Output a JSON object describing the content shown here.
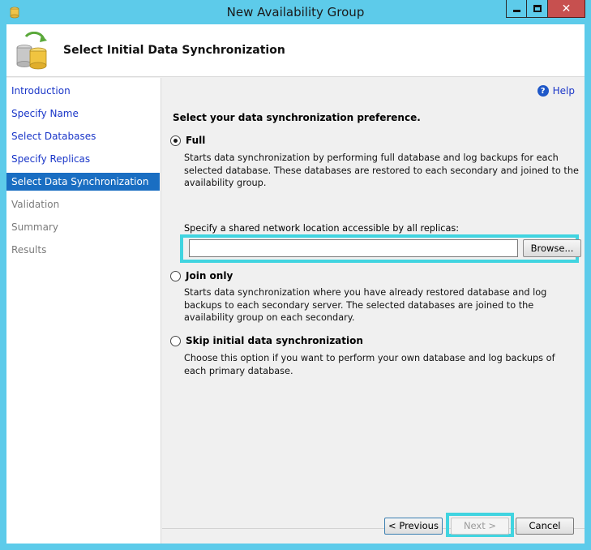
{
  "window": {
    "title": "New Availability Group",
    "close_glyph": "✕"
  },
  "header": {
    "title": "Select Initial Data Synchronization",
    "icon": "database-sync-icon"
  },
  "sidebar": {
    "items": [
      {
        "label": "Introduction",
        "state": "link"
      },
      {
        "label": "Specify Name",
        "state": "link"
      },
      {
        "label": "Select Databases",
        "state": "link"
      },
      {
        "label": "Specify Replicas",
        "state": "link"
      },
      {
        "label": "Select Data Synchronization",
        "state": "active"
      },
      {
        "label": "Validation",
        "state": "disabled"
      },
      {
        "label": "Summary",
        "state": "disabled"
      },
      {
        "label": "Results",
        "state": "disabled"
      }
    ]
  },
  "main": {
    "help_label": "Help",
    "help_icon_glyph": "?",
    "prompt": "Select your data synchronization preference.",
    "options": [
      {
        "label": "Full",
        "selected": true,
        "description": "Starts data synchronization by performing full database and log backups for each selected database. These databases are restored to each secondary and joined to the availability group."
      },
      {
        "label": "Join only",
        "selected": false,
        "description": "Starts data synchronization where you have already restored database and log backups to each secondary server. The selected databases are joined to the availability group on each secondary."
      },
      {
        "label": "Skip initial data synchronization",
        "selected": false,
        "description": "Choose this option if you want to perform your own database and log backups of each primary database."
      }
    ],
    "share_label": "Specify a shared network location accessible by all replicas:",
    "share_value": "",
    "browse_label": "Browse..."
  },
  "footer": {
    "previous_label": "< Previous",
    "next_label": "Next >",
    "cancel_label": "Cancel"
  },
  "colors": {
    "titlebar": "#5dcbea",
    "active_nav": "#1a6ec2",
    "link": "#1a36c8",
    "highlight": "#41d4e0",
    "close_button": "#c7504f"
  }
}
